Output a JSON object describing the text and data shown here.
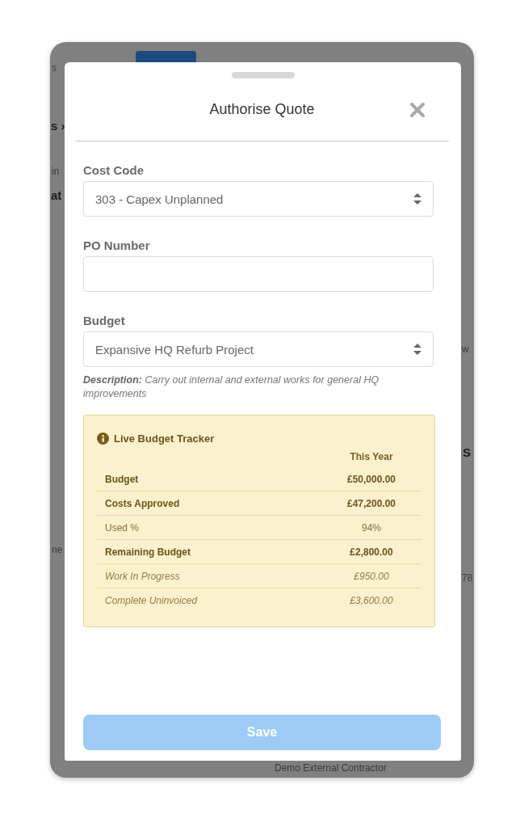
{
  "background_page": {
    "fragments": [
      {
        "text": "s",
        "kind": "plain"
      },
      {
        "text": "s ›",
        "kind": "heading"
      },
      {
        "text": "in",
        "kind": "plain"
      },
      {
        "text": "at",
        "kind": "heading"
      },
      {
        "text": "ne",
        "kind": "plain"
      },
      {
        "text": "w",
        "kind": "plain"
      },
      {
        "text": "S",
        "kind": "heading"
      },
      {
        "text": "78",
        "kind": "plain"
      },
      {
        "text": "Demo External Contractor",
        "kind": "plain"
      }
    ]
  },
  "modal": {
    "title": "Authorise Quote",
    "fields": [
      {
        "label": "Cost Code",
        "kind": "select",
        "value": "303 - Capex Unplanned"
      },
      {
        "label": "PO Number",
        "kind": "text"
      },
      {
        "label": "Budget",
        "kind": "select",
        "value": "Expansive HQ Refurb Project"
      }
    ],
    "description": "**Description:** Carry out internal and external works for general HQ improvements",
    "tracker": {
      "title": "Live Budget Tracker",
      "column": "This Year",
      "rows": [
        {
          "label": "Budget",
          "value": "£50,000.00",
          "kind": "bold"
        },
        {
          "label": "Costs Approved",
          "value": "£47,200.00",
          "kind": "bold"
        },
        {
          "label": "Used %",
          "value": "94%",
          "kind": "normal"
        },
        {
          "label": "Remaining Budget",
          "value": "£2,800.00",
          "kind": "bold"
        },
        {
          "label": "Work In Progress",
          "value": "£950.00",
          "kind": "italic"
        },
        {
          "label": "Complete Uninvoiced",
          "value": "£3,600.00",
          "kind": "italic"
        }
      ]
    },
    "save_button": {
      "label": "Save",
      "disabled": true
    }
  }
}
